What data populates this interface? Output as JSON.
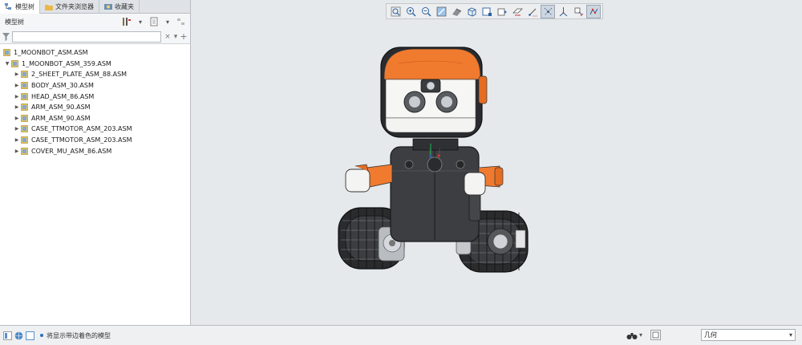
{
  "tabs": [
    {
      "label": "模型树",
      "icon": "model-tree-icon",
      "active": true
    },
    {
      "label": "文件夹浏览器",
      "icon": "folder-icon",
      "active": false
    },
    {
      "label": "收藏夹",
      "icon": "favorites-icon",
      "active": false
    }
  ],
  "panel": {
    "title": "模型树",
    "filter_placeholder": ""
  },
  "tree": [
    {
      "label": "1_MOONBOT_ASM.ASM",
      "level": 0,
      "expander": ""
    },
    {
      "label": "1_MOONBOT_ASM_359.ASM",
      "level": 1,
      "expander": "▼"
    },
    {
      "label": "2_SHEET_PLATE_ASM_88.ASM",
      "level": 2,
      "expander": "▶"
    },
    {
      "label": "BODY_ASM_30.ASM",
      "level": 2,
      "expander": "▶"
    },
    {
      "label": "HEAD_ASM_86.ASM",
      "level": 2,
      "expander": "▶"
    },
    {
      "label": "ARM_ASM_90.ASM",
      "level": 2,
      "expander": "▶"
    },
    {
      "label": "ARM_ASM_90.ASM",
      "level": 2,
      "expander": "▶"
    },
    {
      "label": "CASE_TTMOTOR_ASM_203.ASM",
      "level": 2,
      "expander": "▶"
    },
    {
      "label": "CASE_TTMOTOR_ASM_203.ASM",
      "level": 2,
      "expander": "▶"
    },
    {
      "label": "COVER_MU_ASM_86.ASM",
      "level": 2,
      "expander": "▶"
    }
  ],
  "graphics_toolbar": [
    "refit-icon",
    "zoom-in-icon",
    "zoom-out-icon",
    "repaint-icon",
    "display-style-icon",
    "saved-views-icon",
    "named-view-icon",
    "view-manager-icon",
    "section-icon",
    "sketch-display-icon",
    "datum-plane-display-icon",
    "datum-axis-display-icon",
    "datum-point-display-icon",
    "csys-display-icon"
  ],
  "status": {
    "message": "将显示带边着色的模型",
    "filter_value": "几何"
  },
  "colors": {
    "accent": "#f07a2e",
    "body": "#3a3c3f",
    "background": "#e6e9ec"
  }
}
